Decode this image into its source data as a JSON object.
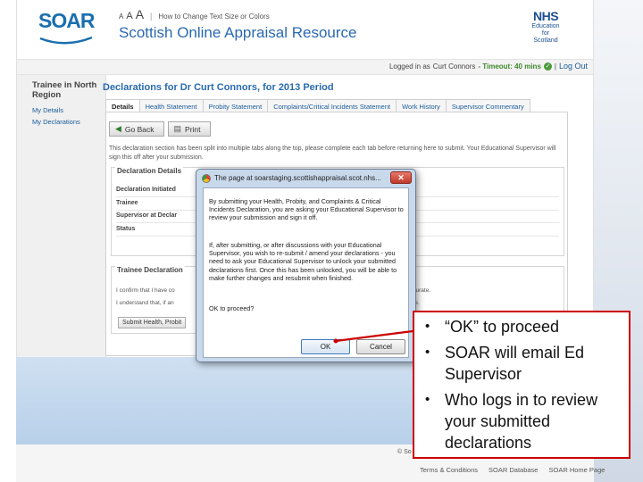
{
  "header": {
    "logo_text": "SOAR",
    "text_size_small": "A",
    "text_size_medium": "A",
    "text_size_large": "A",
    "text_size_separator": "|",
    "text_size_link": "How to Change Text Size or Colors",
    "site_title": "Scottish Online Appraisal Resource",
    "nhs_mark": "NHS",
    "nhs_line1": "Education",
    "nhs_line2": "for",
    "nhs_line3": "Scotland"
  },
  "session": {
    "logged_in_label": "Logged in as",
    "user_name": "Curt Connors",
    "timeout_text": "- Timeout: 40 mins",
    "ok_glyph": "✓",
    "separator": "|",
    "logout_label": "Log Out"
  },
  "sidebar": {
    "region": "Trainee in North Region",
    "items": [
      {
        "label": "My Details"
      },
      {
        "label": "My Declarations"
      }
    ]
  },
  "main": {
    "title_prefix": "Declarations for Dr",
    "person": "Curt Connors",
    "title_suffix": ", for 2013 Period",
    "tabs": [
      {
        "label": "Details",
        "active": true
      },
      {
        "label": "Health Statement"
      },
      {
        "label": "Probity Statement"
      },
      {
        "label": "Complaints/Critical Incidents Statement"
      },
      {
        "label": "Work History"
      },
      {
        "label": "Supervisor Commentary"
      }
    ],
    "go_back_label": "Go Back",
    "go_back_icon": "◀",
    "print_label": "Print",
    "print_icon": "▤",
    "intro": "This declaration section has been split into multiple tabs along the top, please complete each tab before returning here to submit. Your Educational Supervisor will sign this off after your submission.",
    "details_legend": "Declaration Details",
    "details_rows": [
      "Declaration Initiated",
      "Trainee",
      "Supervisor at Declar",
      "Status"
    ],
    "trainee_legend": "Trainee Declaration",
    "trainee_line1": "I confirm that I have co",
    "trainee_line1_end": "ccurate.",
    "trainee_line2": "I understand that, if an",
    "trainee_line2_end": "me.",
    "submit_label": "Submit Health, Probit"
  },
  "dialog": {
    "title": "The page at soarstaging.scottishappraisal.scot.nhs...",
    "close_glyph": "✕",
    "message_p1": "By submitting your Health, Probity, and Complaints & Critical Incidents Declaration, you are asking your Educational Supervisor to review your submission and sign it off.",
    "message_p2": "If, after submitting, or after discussions with your Educational Supervisor, you wish to re-submit / amend your declarations - you need to ask your Educational Supervisor to unlock your submitted declarations first. Once this has been unlocked, you will be able to make further changes and resubmit when finished.",
    "message_p3": "OK to proceed?",
    "ok_label": "OK",
    "cancel_label": "Cancel"
  },
  "footer": {
    "copyright": "© So",
    "links": [
      "Terms & Conditions",
      "SOAR Database",
      "SOAR Home Page"
    ]
  },
  "callout": {
    "bullet_glyph": "•",
    "items": [
      "“OK” to proceed",
      "SOAR will email Ed Supervisor",
      "Who logs in to review your submitted declarations"
    ],
    "border_color": "#cc0000"
  }
}
